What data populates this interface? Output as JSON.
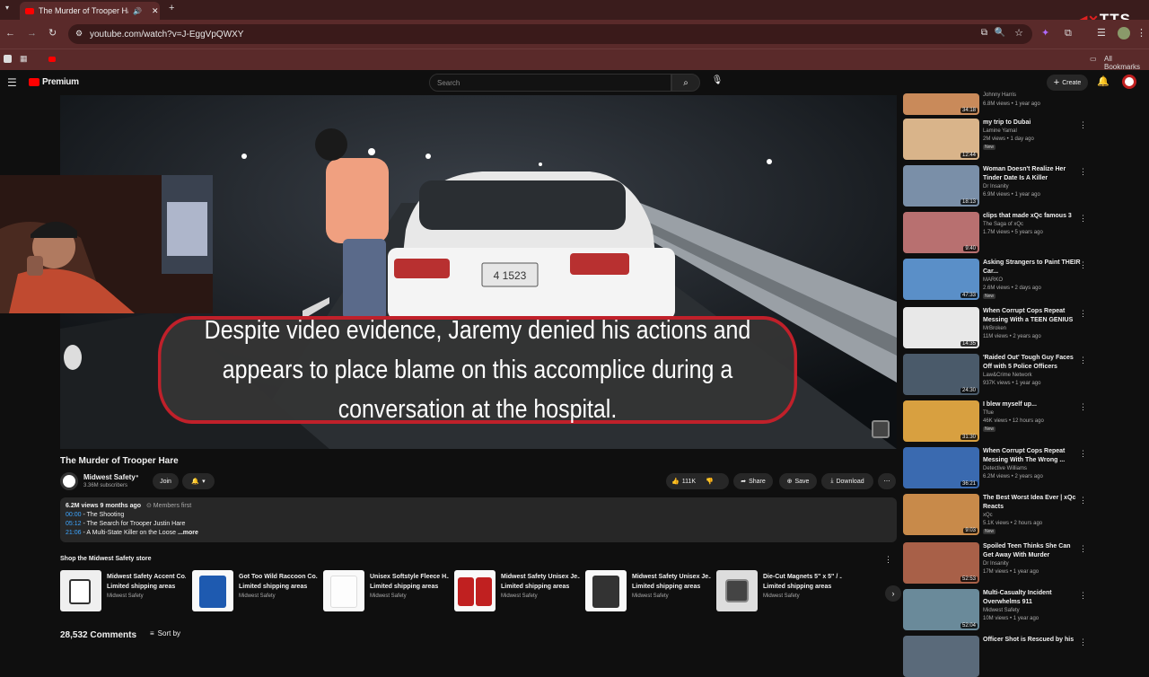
{
  "browser": {
    "tab_title": "The Murder of Trooper Hare",
    "url": "youtube.com/watch?v=J-EggVpQWXY",
    "bookmarks_label": "All Bookmarks",
    "overlay_logo": "TTS"
  },
  "header": {
    "brand": "Premium",
    "search_placeholder": "Search",
    "create_label": "Create"
  },
  "video": {
    "plate_text": "4 1523",
    "caption": "Despite video evidence, Jaremy denied his actions and appears to place blame on this accomplice during a conversation at the hospital."
  },
  "info": {
    "title": "The Murder of Trooper Hare",
    "channel": "Midwest Safety",
    "subscribers": "3.36M subscribers",
    "join_label": "Join",
    "likes": "111K",
    "share_label": "Share",
    "save_label": "Save",
    "download_label": "Download"
  },
  "description": {
    "stats": "6.2M views  9 months ago",
    "members": "Members first",
    "chapters": [
      {
        "time": "00:00",
        "text": " - The Shooting"
      },
      {
        "time": "05:12",
        "text": " - The Search for Trooper Justin Hare"
      },
      {
        "time": "21:06",
        "text": " - A Multi-State Killer on the Loose"
      }
    ],
    "more": "...more"
  },
  "store": {
    "heading": "Shop the Midwest Safety store",
    "items": [
      {
        "name": "Midwest Safety Accent Co...",
        "shipping": "Limited shipping areas",
        "seller": "Midwest Safety"
      },
      {
        "name": "Got Too Wild Raccoon Co...",
        "shipping": "Limited shipping areas",
        "seller": "Midwest Safety"
      },
      {
        "name": "Unisex Softstyle Fleece H...",
        "shipping": "Limited shipping areas",
        "seller": "Midwest Safety"
      },
      {
        "name": "Midwest Safety Unisex Je...",
        "shipping": "Limited shipping areas",
        "seller": "Midwest Safety"
      },
      {
        "name": "Midwest Safety Unisex Je...",
        "shipping": "Limited shipping areas",
        "seller": "Midwest Safety"
      },
      {
        "name": "Die-Cut Magnets 5\" x 5\" / ...",
        "shipping": "Limited shipping areas",
        "seller": "Midwest Safety"
      }
    ]
  },
  "comments": {
    "count": "28,532 Comments",
    "sort_label": "Sort by"
  },
  "sidebar": [
    {
      "title": "",
      "channel": "Johnny Harris",
      "meta": "6.8M views • 1 year ago",
      "duration": "34:18",
      "new": "",
      "color": "#c98a5a"
    },
    {
      "title": "my trip to Dubai",
      "channel": "Lamine Yamal",
      "meta": "2M views • 1 day ago",
      "duration": "12:44",
      "new": "New",
      "color": "#d9b48a"
    },
    {
      "title": "Woman Doesn't Realize Her Tinder Date Is A Killer",
      "channel": "Dr Insanity",
      "meta": "6.9M views • 1 year ago",
      "duration": "18:13",
      "new": "",
      "color": "#7a8fa8"
    },
    {
      "title": "clips that made xQc famous 3",
      "channel": "The Saga of xQc",
      "meta": "1.7M views • 5 years ago",
      "duration": "9:40",
      "new": "",
      "color": "#b87070"
    },
    {
      "title": "Asking Strangers to Paint THEIR Car...",
      "channel": "MARKO",
      "meta": "2.6M views • 2 days ago",
      "duration": "47:33",
      "new": "New",
      "color": "#5a8fc8"
    },
    {
      "title": "When Corrupt Cops Repeat Messing With a TEEN GENIUS",
      "channel": "MrBroken",
      "meta": "11M views • 2 years ago",
      "duration": "14:35",
      "new": "",
      "color": "#e8e8e8"
    },
    {
      "title": "'Raided Out' Tough Guy Faces Off with 5 Police Officers",
      "channel": "Law&Crime Network",
      "meta": "937K views • 1 year ago",
      "duration": "24:30",
      "new": "",
      "color": "#4a5a6a"
    },
    {
      "title": "I blew myself up...",
      "channel": "Tfue",
      "meta": "46K views • 12 hours ago",
      "duration": "31:30",
      "new": "New",
      "color": "#d8a040"
    },
    {
      "title": "When Corrupt Cops Repeat Messing With The Wrong ...",
      "channel": "Detective Williams",
      "meta": "6.2M views • 2 years ago",
      "duration": "36:21",
      "new": "",
      "color": "#3a6ab0"
    },
    {
      "title": "The Best Worst Idea Ever | xQc Reacts",
      "channel": "xQc",
      "meta": "5.1K views • 2 hours ago",
      "duration": "9:03",
      "new": "New",
      "color": "#c88a4a"
    },
    {
      "title": "Spoiled Teen Thinks She Can Get Away With Murder",
      "channel": "Dr Insanity",
      "meta": "17M views • 1 year ago",
      "duration": "52:53",
      "new": "",
      "color": "#a86048"
    },
    {
      "title": "Multi-Casualty Incident Overwhelms 911",
      "channel": "Midwest Safety",
      "meta": "10M views • 1 year ago",
      "duration": "52:04",
      "new": "",
      "color": "#6a8a9a"
    },
    {
      "title": "Officer Shot is Rescued by his",
      "channel": "",
      "meta": "",
      "duration": "",
      "new": "",
      "color": "#5a6a7a"
    }
  ]
}
